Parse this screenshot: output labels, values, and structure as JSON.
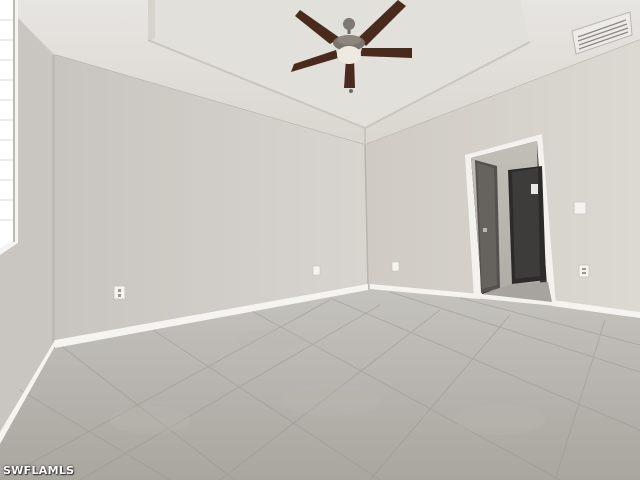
{
  "photo": {
    "subject": "vacant-bedroom-interior",
    "watermark_text": "SWFLAMLS"
  },
  "colors": {
    "wall_left": "#d4d0cb",
    "wall_back": "#cbc6c0",
    "wall_right": "#d8d4ce",
    "ceiling": "#e6e4df",
    "floor": "#b2afa9",
    "fan_blade": "#4a2a1c",
    "trim": "#f3f2ef"
  }
}
